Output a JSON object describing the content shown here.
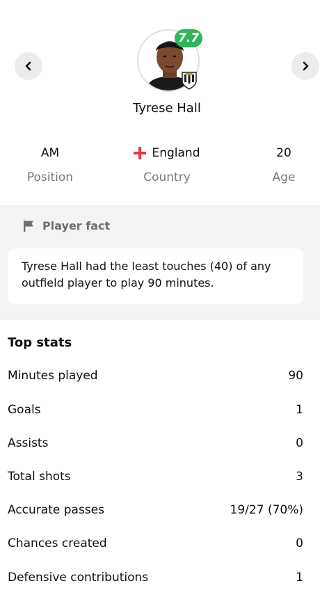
{
  "player": {
    "name": "Tyrese Hall",
    "rating": "7.7",
    "position": "AM",
    "position_label": "Position",
    "country": "England",
    "country_label": "Country",
    "age": "20",
    "age_label": "Age"
  },
  "fact": {
    "title": "Player fact",
    "text": "Tyrese Hall had the least touches (40) of any outfield player to play 90 minutes."
  },
  "top_stats": {
    "title": "Top stats",
    "rows": [
      {
        "label": "Minutes played",
        "value": "90"
      },
      {
        "label": "Goals",
        "value": "1"
      },
      {
        "label": "Assists",
        "value": "0"
      },
      {
        "label": "Total shots",
        "value": "3"
      },
      {
        "label": "Accurate passes",
        "value": "19/27 (70%)"
      },
      {
        "label": "Chances created",
        "value": "0"
      },
      {
        "label": "Defensive contributions",
        "value": "1"
      }
    ]
  },
  "icons": {
    "prev": "chevron-left-icon",
    "next": "chevron-right-icon",
    "flag": "england-flag-icon",
    "fact": "flag-icon",
    "club": "club-crest-icon"
  },
  "colors": {
    "rating_bg": "#2fb55a",
    "section_bg": "#f3f3f3",
    "muted_text": "#777777"
  }
}
